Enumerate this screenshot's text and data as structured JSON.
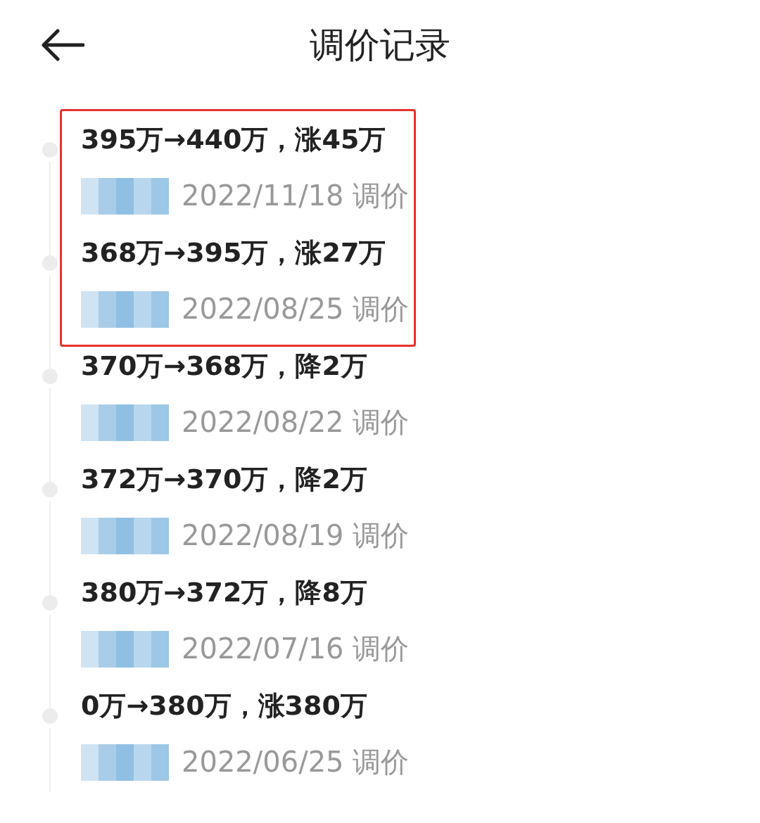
{
  "header": {
    "title": "调价记录"
  },
  "records": [
    {
      "change": "395万→440万，涨45万",
      "date": "2022/11/18 调价",
      "highlighted": true
    },
    {
      "change": "368万→395万，涨27万",
      "date": "2022/08/25 调价",
      "highlighted": true
    },
    {
      "change": "370万→368万，降2万",
      "date": "2022/08/22 调价",
      "highlighted": false
    },
    {
      "change": "372万→370万，降2万",
      "date": "2022/08/19 调价",
      "highlighted": false
    },
    {
      "change": "380万→372万，降8万",
      "date": "2022/07/16 调价",
      "highlighted": false
    },
    {
      "change": "0万→380万，涨380万",
      "date": "2022/06/25 调价",
      "highlighted": false
    }
  ]
}
